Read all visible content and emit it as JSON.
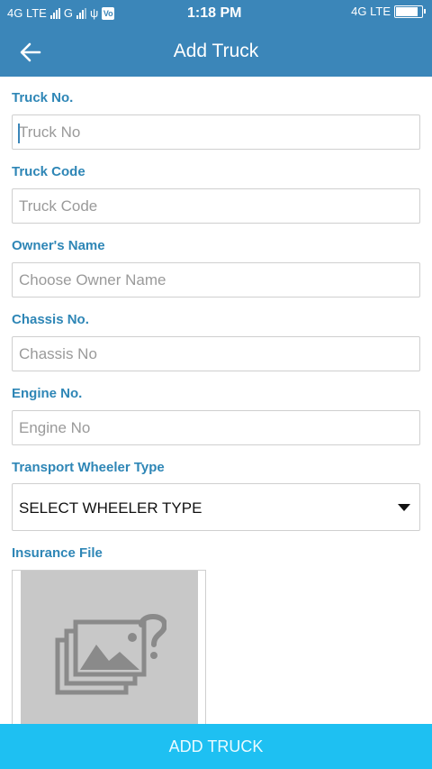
{
  "status_bar": {
    "left_text_1": "4G LTE",
    "left_text_2": "G",
    "sim_badge": "Vo",
    "time": "1:18 PM",
    "right_text": "4G LTE",
    "battery_level": 0.85
  },
  "app_bar": {
    "title": "Add Truck",
    "back_icon": "arrow-left-icon"
  },
  "form": {
    "truck_no": {
      "label": "Truck No.",
      "placeholder": "Truck No",
      "value": ""
    },
    "truck_code": {
      "label": "Truck Code",
      "placeholder": "Truck Code",
      "value": ""
    },
    "owner_name": {
      "label": "Owner's Name",
      "placeholder": "Choose Owner Name",
      "value": ""
    },
    "chassis_no": {
      "label": "Chassis No.",
      "placeholder": "Chassis No",
      "value": ""
    },
    "engine_no": {
      "label": "Engine No.",
      "placeholder": "Engine No",
      "value": ""
    },
    "wheeler_type": {
      "label": "Transport Wheeler Type",
      "selected": "SELECT WHEELER TYPE"
    },
    "insurance_file": {
      "label": "Insurance File",
      "icon": "image-placeholder-icon"
    }
  },
  "submit_label": "ADD TRUCK",
  "colors": {
    "app_bar": "#3b86b9",
    "label": "#2e86b6",
    "submit": "#1ec0f2",
    "placeholder_bg": "#c8c8c8"
  }
}
